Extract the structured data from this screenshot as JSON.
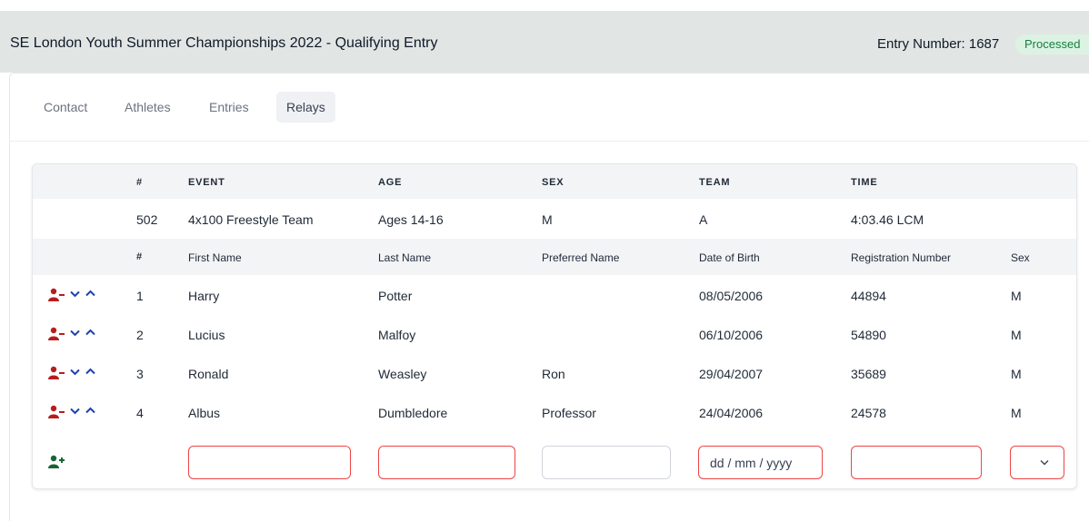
{
  "header": {
    "title": "SE London Youth Summer Championships 2022 - Qualifying Entry",
    "entry_number": "Entry Number: 1687",
    "status": "Processed"
  },
  "tabs": [
    {
      "label": "Contact",
      "active": false
    },
    {
      "label": "Athletes",
      "active": false
    },
    {
      "label": "Entries",
      "active": false
    },
    {
      "label": "Relays",
      "active": true
    }
  ],
  "event_header": {
    "number": "#",
    "event": "EVENT",
    "age": "AGE",
    "sex": "SEX",
    "team": "TEAM",
    "time": "TIME"
  },
  "event": {
    "number": "502",
    "event": "4x100 Freestyle Team",
    "age": "Ages 14-16",
    "sex": "M",
    "team": "A",
    "time": "4:03.46 LCM"
  },
  "athlete_header": {
    "number": "#",
    "first_name": "First Name",
    "last_name": "Last Name",
    "preferred_name": "Preferred Name",
    "dob": "Date of Birth",
    "registration": "Registration Number",
    "sex": "Sex"
  },
  "athletes": [
    {
      "num": "1",
      "first": "Harry",
      "last": "Potter",
      "preferred": "",
      "dob": "08/05/2006",
      "reg": "44894",
      "sex": "M"
    },
    {
      "num": "2",
      "first": "Lucius",
      "last": "Malfoy",
      "preferred": "",
      "dob": "06/10/2006",
      "reg": "54890",
      "sex": "M"
    },
    {
      "num": "3",
      "first": "Ronald",
      "last": "Weasley",
      "preferred": "Ron",
      "dob": "29/04/2007",
      "reg": "35689",
      "sex": "M"
    },
    {
      "num": "4",
      "first": "Albus",
      "last": "Dumbledore",
      "preferred": "Professor",
      "dob": "24/04/2006",
      "reg": "24578",
      "sex": "M"
    }
  ],
  "new_athlete": {
    "first_name": "",
    "last_name": "",
    "preferred_name": "",
    "dob_placeholder": "dd / mm / yyyy",
    "registration": "",
    "sex": ""
  },
  "icons": {
    "remove": "user-minus-icon",
    "down": "chevron-down-icon",
    "up": "chevron-up-icon",
    "add": "user-plus-icon",
    "select": "chevron-down-icon"
  },
  "colors": {
    "header_bg": "#e1e6e5",
    "status_bg": "#dcf3e4",
    "status_text": "#15803d",
    "remove_icon": "#b91c1c",
    "chevron": "#1e40af",
    "add_icon": "#166534",
    "invalid_border": "#ef4444"
  }
}
